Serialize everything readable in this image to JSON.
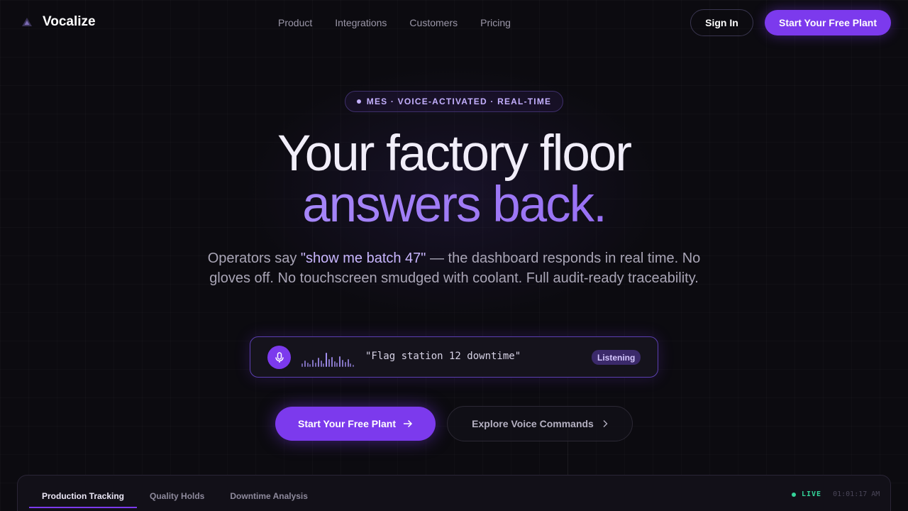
{
  "brand": {
    "name": "Vocalize",
    "icon": "triangle-logo-icon"
  },
  "nav": {
    "links": [
      "Product",
      "Integrations",
      "Customers",
      "Pricing"
    ],
    "sign_in": "Sign In",
    "cta": "Start Your Free Plant"
  },
  "hero": {
    "badge": "MES · VOICE-ACTIVATED · REAL-TIME",
    "headline_line1": "Your factory floor",
    "headline_line2": "answers back.",
    "sub_prefix": "Operators say ",
    "sub_quote": "\"show me batch 47\"",
    "sub_suffix": " — the dashboard responds in real time. No gloves off. No touchscreen smudged with coolant. Full audit-ready traceability."
  },
  "voice_bar": {
    "mic_icon": "microphone-icon",
    "command": "\"Flag station 12 downtime\"",
    "status": "Listening"
  },
  "ctas": {
    "primary": "Start Your Free Plant",
    "primary_icon": "arrow-right-icon",
    "secondary": "Explore Voice Commands",
    "secondary_icon": "chevron-right-icon"
  },
  "panel": {
    "tabs": [
      "Production Tracking",
      "Quality Holds",
      "Downtime Analysis"
    ],
    "active_tab": "Production Tracking",
    "live_label": "LIVE",
    "clock": "01:01:17 AM"
  },
  "colors": {
    "accent": "#7c3aed",
    "accent_light": "#c4b0ff",
    "live_green": "#34d399",
    "background": "#0c0b10"
  }
}
